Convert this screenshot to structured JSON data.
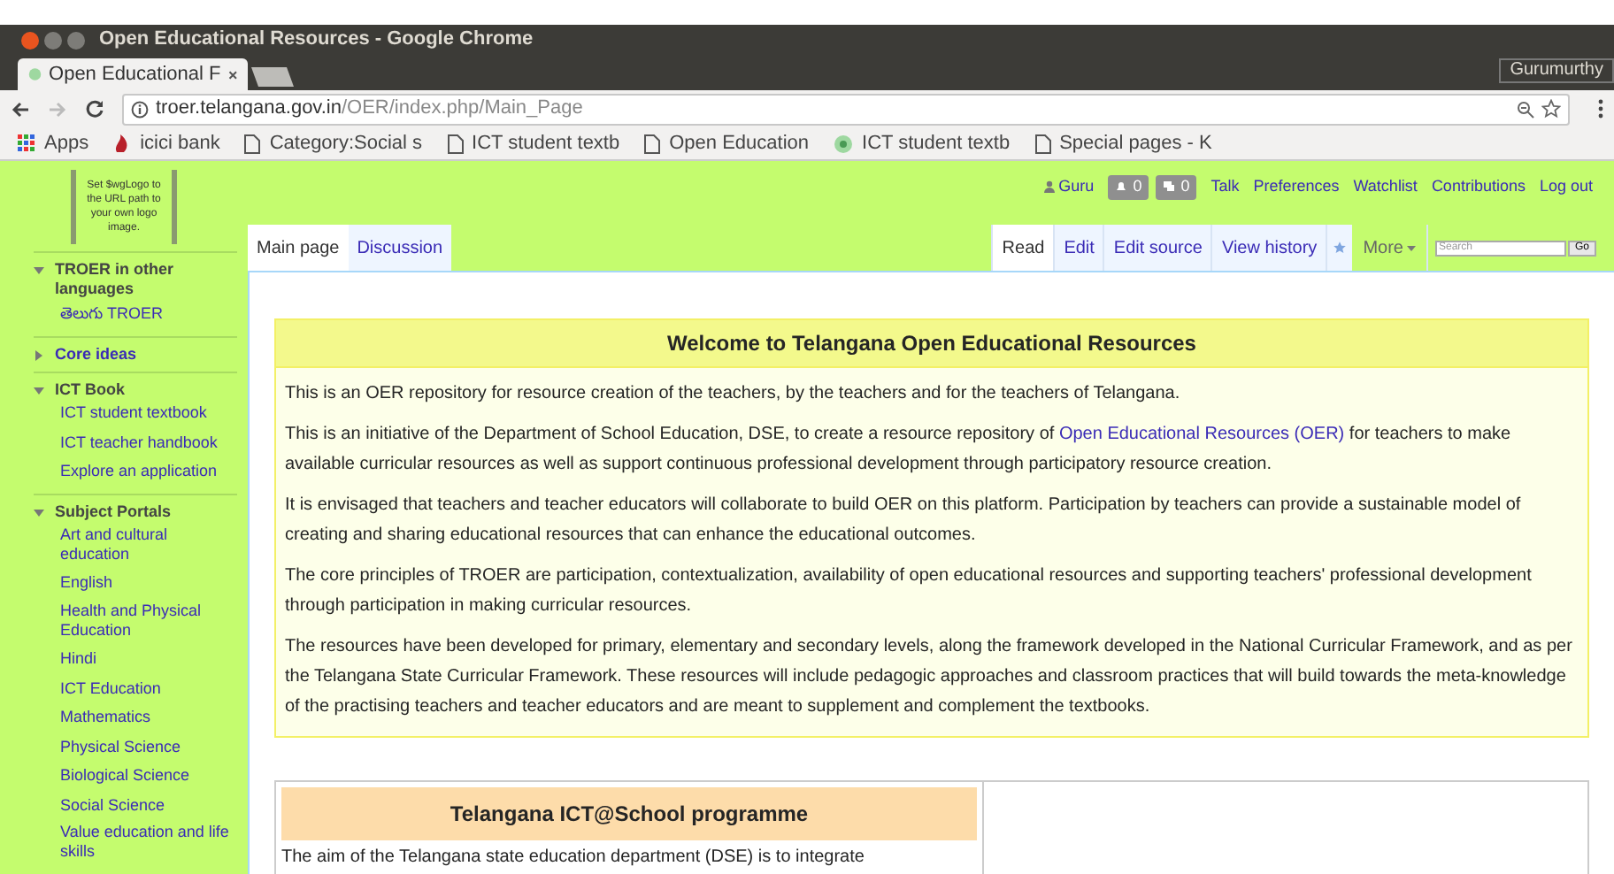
{
  "window": {
    "title": "Open Educational Resources - Google Chrome",
    "user": "Gurumurthy"
  },
  "tabs": [
    {
      "label": "Open Educational F",
      "selected": true
    }
  ],
  "address": {
    "host": "troer.telangana.gov.in",
    "path": "/OER/index.php/Main_Page"
  },
  "bookmarks": [
    {
      "label": "Apps",
      "kind": "apps"
    },
    {
      "label": "icici bank",
      "kind": "site"
    },
    {
      "label": "Category:Social s",
      "kind": "page"
    },
    {
      "label": "ICT student textb",
      "kind": "page"
    },
    {
      "label": "Open Education",
      "kind": "page"
    },
    {
      "label": "ICT student textb",
      "kind": "wiki"
    },
    {
      "label": "Special pages - K",
      "kind": "page"
    }
  ],
  "logo_text": "Set $wgLogo to the URL path to your own logo image.",
  "sidebar": [
    {
      "heading": "TROER in other languages",
      "expanded": true,
      "items": [
        "తెలుగు TROER"
      ]
    },
    {
      "heading": "Core ideas",
      "expanded": false
    },
    {
      "heading": "ICT Book",
      "expanded": true,
      "items": [
        "ICT student textbook",
        "ICT teacher handbook",
        "Explore an application"
      ]
    },
    {
      "heading": "Subject Portals",
      "expanded": true,
      "items": [
        "Art and cultural education",
        "English",
        "Health and Physical Education",
        "Hindi",
        "ICT Education",
        "Mathematics",
        "Physical Science",
        "Biological Science",
        "Social Science",
        "Value education and life skills"
      ]
    }
  ],
  "personal": {
    "user": "Guru",
    "alerts": "0",
    "notices": "0",
    "links": [
      "Talk",
      "Preferences",
      "Watchlist",
      "Contributions",
      "Log out"
    ]
  },
  "namespaces": [
    {
      "label": "Main page",
      "selected": true
    },
    {
      "label": "Discussion",
      "selected": false
    }
  ],
  "views": [
    {
      "label": "Read",
      "selected": true
    },
    {
      "label": "Edit",
      "selected": false
    },
    {
      "label": "Edit source",
      "selected": false
    },
    {
      "label": "View history",
      "selected": false
    }
  ],
  "more": "More",
  "search": {
    "placeholder": "Search",
    "button": "Go"
  },
  "welcome": {
    "title": "Welcome to Telangana Open Educational Resources",
    "paragraphs": [
      "This is an OER repository for resource creation of the teachers, by the teachers and for the teachers of Telangana.",
      [
        {
          "text": "This is an initiative of the Department of School Education, DSE, to create a resource repository of ",
          "kind": "plain"
        },
        {
          "text": "Open Educational Resources (OER)",
          "kind": "link"
        },
        {
          "text": " for teachers to make available curricular resources as well as support continuous professional development through participatory resource creation.",
          "kind": "plain"
        }
      ],
      "It is envisaged that teachers and teacher educators will collaborate to build OER on this platform. Participation by teachers can provide a sustainable model of creating and sharing educational resources that can enhance the educational outcomes.",
      "The core principles of TROER are participation, contextualization, availability of open educational resources and supporting teachers' professional development through participation in making curricular resources.",
      "The resources have been developed for primary, elementary and secondary levels, along the framework developed in the National Curricular Framework, and as per the Telangana State Curricular Framework. These resources will include pedagogic approaches and classroom practices that will build towards the meta-knowledge of the practising teachers and teacher educators and are meant to supplement and complement the textbooks."
    ]
  },
  "ict": {
    "title": "Telangana ICT@School programme",
    "text": "The aim of the Telangana state education department (DSE) is to integrate"
  }
}
